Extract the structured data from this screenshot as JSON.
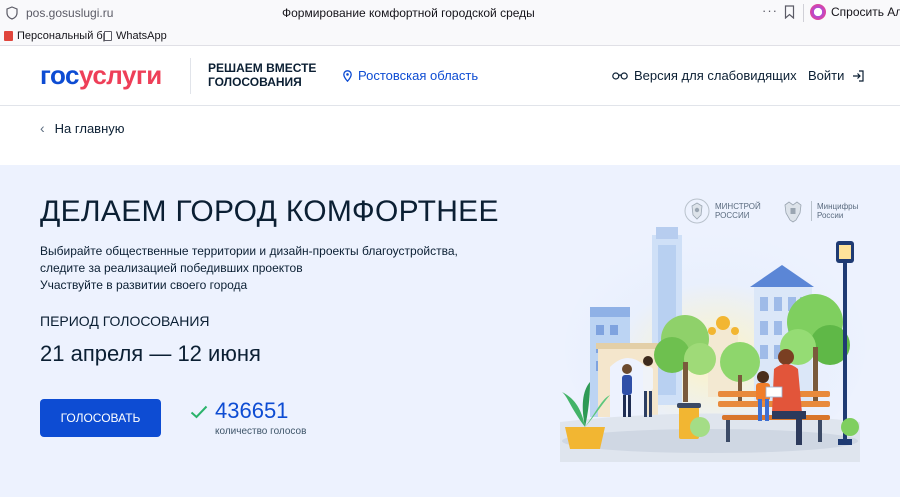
{
  "browser": {
    "url": "pos.gosuslugi.ru",
    "tab_title": "Формирование комфортной городской среды",
    "menu_dots": "···",
    "alice_label": "Спросить Алис",
    "bookmarks": [
      "Персональный бр",
      "WhatsApp"
    ]
  },
  "header": {
    "logo_part1": "гос",
    "logo_part2": "услуги",
    "slogan_line1": "РЕШАЕМ ВМЕСТЕ",
    "slogan_line2": "ГОЛОСОВАНИЯ",
    "region": "Ростовская область",
    "low_vision": "Версия для слабовидящих",
    "login": "Войти"
  },
  "nav": {
    "back": "На главную"
  },
  "hero": {
    "title": "ДЕЛАЕМ ГОРОД КОМФОРТНЕЕ",
    "description": [
      "Выбирайте общественные территории и дизайн-проекты благоустройства,",
      "следите за реализацией победивших проектов",
      "Участвуйте в развитии своего города"
    ],
    "period_label": "ПЕРИОД ГОЛОСОВАНИЯ",
    "period_dates": "21 апреля — 12 июня",
    "vote_button": "ГОЛОСОВАТЬ",
    "vote_count": "436651",
    "vote_count_label": "количество голосов",
    "ministries": [
      {
        "line1": "МИНСТРОЙ",
        "line2": "РОССИИ"
      },
      {
        "line1": "Минцифры",
        "line2": "России"
      }
    ]
  },
  "colors": {
    "brand_blue": "#0d4cd3",
    "brand_red": "#ee3f58",
    "hero_bg": "#edf2fe"
  }
}
